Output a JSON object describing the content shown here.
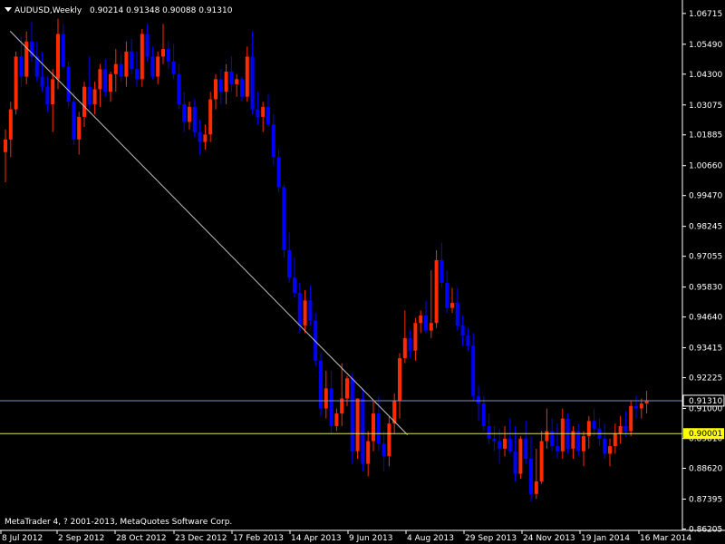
{
  "header": {
    "symbol": "AUDUSD,Weekly",
    "ohlc": "0.90214 0.91348 0.90088 0.91310"
  },
  "footer": {
    "copyright": "MetaTrader 4, ? 2001-2013, MetaQuotes Software Corp."
  },
  "colors": {
    "background": "#000000",
    "bull": "#FF2A00",
    "bear": "#0000FF",
    "axis": "#FFFFFF",
    "bid_line": "#8090C0",
    "level_line": "#E0E060",
    "trend_line": "#C0C0C0",
    "price_tag_bid_bg": "#000000",
    "price_tag_level_bg": "#FFFF00"
  },
  "chart_data": {
    "type": "candlestick",
    "ylim": [
      0.8615,
      1.0725
    ],
    "y_ticks": [
      "1.06715",
      "1.05490",
      "1.04300",
      "1.03075",
      "1.01885",
      "1.00660",
      "0.99470",
      "0.98245",
      "0.97055",
      "0.95830",
      "0.94640",
      "0.93415",
      "0.92225",
      "0.91000",
      "0.89810",
      "0.88620",
      "0.87395",
      "0.86205"
    ],
    "x_labels": [
      "8 Jul 2012",
      "2 Sep 2012",
      "28 Oct 2012",
      "23 Dec 2012",
      "17 Feb 2013",
      "14 Apr 2013",
      "9 Jun 2013",
      "4 Aug 2013",
      "29 Sep 2013",
      "24 Nov 2013",
      "19 Jan 2014",
      "16 Mar 2014"
    ],
    "bid_price": "0.91310",
    "bid_value": 0.9131,
    "level_price": "0.90001",
    "level_value": 0.90001,
    "trendline": [
      [
        0.9,
        1.0601
      ],
      [
        76.5,
        0.8995
      ]
    ],
    "candles": [
      [
        1.012,
        1.021,
        1.0,
        1.017
      ],
      [
        1.017,
        1.032,
        1.01,
        1.029
      ],
      [
        1.029,
        1.052,
        1.027,
        1.05
      ],
      [
        1.05,
        1.058,
        1.038,
        1.042
      ],
      [
        1.042,
        1.06,
        1.039,
        1.056
      ],
      [
        1.056,
        1.064,
        1.048,
        1.05
      ],
      [
        1.05,
        1.056,
        1.04,
        1.042
      ],
      [
        1.042,
        1.052,
        1.036,
        1.038
      ],
      [
        1.038,
        1.042,
        1.028,
        1.031
      ],
      [
        1.031,
        1.045,
        1.02,
        1.041
      ],
      [
        1.041,
        1.065,
        1.037,
        1.059
      ],
      [
        1.059,
        1.063,
        1.045,
        1.046
      ],
      [
        1.046,
        1.048,
        1.03,
        1.032
      ],
      [
        1.032,
        1.036,
        1.015,
        1.017
      ],
      [
        1.017,
        1.028,
        1.011,
        1.026
      ],
      [
        1.026,
        1.04,
        1.022,
        1.038
      ],
      [
        1.038,
        1.05,
        1.029,
        1.031
      ],
      [
        1.031,
        1.04,
        1.027,
        1.037
      ],
      [
        1.037,
        1.047,
        1.03,
        1.045
      ],
      [
        1.045,
        1.049,
        1.034,
        1.036
      ],
      [
        1.036,
        1.044,
        1.032,
        1.043
      ],
      [
        1.043,
        1.053,
        1.036,
        1.047
      ],
      [
        1.047,
        1.051,
        1.04,
        1.042
      ],
      [
        1.042,
        1.056,
        1.038,
        1.052
      ],
      [
        1.052,
        1.057,
        1.043,
        1.045
      ],
      [
        1.045,
        1.052,
        1.038,
        1.041
      ],
      [
        1.041,
        1.061,
        1.038,
        1.059
      ],
      [
        1.059,
        1.063,
        1.048,
        1.05
      ],
      [
        1.05,
        1.054,
        1.041,
        1.042
      ],
      [
        1.042,
        1.052,
        1.039,
        1.05
      ],
      [
        1.05,
        1.063,
        1.047,
        1.053
      ],
      [
        1.053,
        1.056,
        1.045,
        1.048
      ],
      [
        1.048,
        1.055,
        1.041,
        1.043
      ],
      [
        1.043,
        1.047,
        1.029,
        1.031
      ],
      [
        1.031,
        1.036,
        1.02,
        1.024
      ],
      [
        1.024,
        1.032,
        1.021,
        1.03
      ],
      [
        1.03,
        1.033,
        1.018,
        1.02
      ],
      [
        1.02,
        1.025,
        1.011,
        1.016
      ],
      [
        1.016,
        1.023,
        1.013,
        1.019
      ],
      [
        1.019,
        1.036,
        1.016,
        1.033
      ],
      [
        1.033,
        1.043,
        1.029,
        1.041
      ],
      [
        1.041,
        1.045,
        1.031,
        1.036
      ],
      [
        1.036,
        1.047,
        1.031,
        1.044
      ],
      [
        1.044,
        1.05,
        1.036,
        1.039
      ],
      [
        1.039,
        1.043,
        1.034,
        1.041
      ],
      [
        1.041,
        1.042,
        1.032,
        1.034
      ],
      [
        1.034,
        1.054,
        1.032,
        1.05
      ],
      [
        1.05,
        1.06,
        1.027,
        1.029
      ],
      [
        1.029,
        1.036,
        1.023,
        1.026
      ],
      [
        1.026,
        1.032,
        1.02,
        1.03
      ],
      [
        1.03,
        1.035,
        1.022,
        1.023
      ],
      [
        1.023,
        1.027,
        1.007,
        1.01
      ],
      [
        1.01,
        1.013,
        0.996,
        0.998
      ],
      [
        0.998,
        0.999,
        0.97,
        0.973
      ],
      [
        0.973,
        0.98,
        0.96,
        0.962
      ],
      [
        0.962,
        0.97,
        0.954,
        0.956
      ],
      [
        0.956,
        0.96,
        0.94,
        0.943
      ],
      [
        0.943,
        0.957,
        0.94,
        0.953
      ],
      [
        0.953,
        0.959,
        0.943,
        0.945
      ],
      [
        0.945,
        0.948,
        0.927,
        0.929
      ],
      [
        0.929,
        0.932,
        0.907,
        0.91
      ],
      [
        0.91,
        0.925,
        0.906,
        0.918
      ],
      [
        0.918,
        0.925,
        0.9,
        0.903
      ],
      [
        0.903,
        0.91,
        0.901,
        0.908
      ],
      [
        0.908,
        0.928,
        0.903,
        0.914
      ],
      [
        0.914,
        0.923,
        0.911,
        0.922
      ],
      [
        0.922,
        0.924,
        0.888,
        0.893
      ],
      [
        0.893,
        0.912,
        0.89,
        0.914
      ],
      [
        0.914,
        0.918,
        0.885,
        0.888
      ],
      [
        0.888,
        0.901,
        0.883,
        0.897
      ],
      [
        0.897,
        0.913,
        0.893,
        0.908
      ],
      [
        0.908,
        0.915,
        0.893,
        0.896
      ],
      [
        0.896,
        0.901,
        0.885,
        0.891
      ],
      [
        0.891,
        0.907,
        0.887,
        0.904
      ],
      [
        0.904,
        0.916,
        0.9,
        0.913
      ],
      [
        0.913,
        0.932,
        0.906,
        0.93
      ],
      [
        0.93,
        0.949,
        0.928,
        0.938
      ],
      [
        0.938,
        0.941,
        0.93,
        0.933
      ],
      [
        0.933,
        0.946,
        0.929,
        0.944
      ],
      [
        0.944,
        0.949,
        0.94,
        0.947
      ],
      [
        0.947,
        0.953,
        0.94,
        0.941
      ],
      [
        0.941,
        0.965,
        0.938,
        0.944
      ],
      [
        0.944,
        0.973,
        0.942,
        0.969
      ],
      [
        0.969,
        0.976,
        0.958,
        0.96
      ],
      [
        0.96,
        0.965,
        0.948,
        0.95
      ],
      [
        0.95,
        0.958,
        0.948,
        0.952
      ],
      [
        0.952,
        0.958,
        0.941,
        0.943
      ],
      [
        0.943,
        0.947,
        0.935,
        0.939
      ],
      [
        0.939,
        0.942,
        0.933,
        0.935
      ],
      [
        0.935,
        0.94,
        0.913,
        0.915
      ],
      [
        0.915,
        0.919,
        0.905,
        0.912
      ],
      [
        0.912,
        0.915,
        0.901,
        0.903
      ],
      [
        0.903,
        0.908,
        0.896,
        0.898
      ],
      [
        0.898,
        0.903,
        0.893,
        0.897
      ],
      [
        0.897,
        0.902,
        0.888,
        0.894
      ],
      [
        0.894,
        0.903,
        0.891,
        0.898
      ],
      [
        0.898,
        0.906,
        0.892,
        0.893
      ],
      [
        0.893,
        0.903,
        0.881,
        0.884
      ],
      [
        0.884,
        0.899,
        0.882,
        0.898
      ],
      [
        0.898,
        0.905,
        0.888,
        0.89
      ],
      [
        0.89,
        0.899,
        0.873,
        0.876
      ],
      [
        0.876,
        0.894,
        0.874,
        0.881
      ],
      [
        0.881,
        0.901,
        0.88,
        0.897
      ],
      [
        0.897,
        0.91,
        0.894,
        0.901
      ],
      [
        0.901,
        0.906,
        0.893,
        0.895
      ],
      [
        0.895,
        0.904,
        0.89,
        0.893
      ],
      [
        0.893,
        0.91,
        0.89,
        0.906
      ],
      [
        0.906,
        0.908,
        0.892,
        0.894
      ],
      [
        0.894,
        0.903,
        0.89,
        0.901
      ],
      [
        0.901,
        0.904,
        0.891,
        0.893
      ],
      [
        0.893,
        0.901,
        0.887,
        0.899
      ],
      [
        0.899,
        0.907,
        0.894,
        0.905
      ],
      [
        0.905,
        0.91,
        0.899,
        0.902
      ],
      [
        0.902,
        0.906,
        0.895,
        0.898
      ],
      [
        0.898,
        0.904,
        0.89,
        0.892
      ],
      [
        0.892,
        0.898,
        0.887,
        0.895
      ],
      [
        0.895,
        0.904,
        0.892,
        0.9
      ],
      [
        0.9,
        0.907,
        0.896,
        0.903
      ],
      [
        0.903,
        0.909,
        0.899,
        0.901
      ],
      [
        0.901,
        0.913,
        0.899,
        0.911
      ],
      [
        0.911,
        0.915,
        0.906,
        0.91
      ],
      [
        0.91,
        0.914,
        0.906,
        0.912
      ],
      [
        0.912,
        0.917,
        0.908,
        0.9131
      ]
    ]
  }
}
